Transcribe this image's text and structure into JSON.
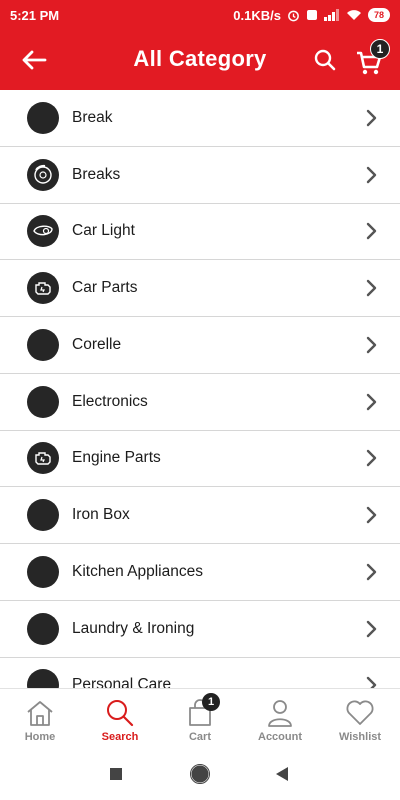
{
  "status_bar": {
    "time": "5:21 PM",
    "network_speed": "0.1KB/s",
    "battery": "78"
  },
  "app_bar": {
    "title": "All Category",
    "cart_badge": "1",
    "back_icon": "arrow-left-icon",
    "search_icon": "search-icon",
    "cart_icon": "cart-icon"
  },
  "categories": [
    {
      "label": "Break",
      "icon": "blank"
    },
    {
      "label": "Breaks",
      "icon": "brake-disc-icon"
    },
    {
      "label": "Car Light",
      "icon": "headlight-icon"
    },
    {
      "label": "Car Parts",
      "icon": "engine-icon"
    },
    {
      "label": "Corelle",
      "icon": "blank"
    },
    {
      "label": "Electronics",
      "icon": "blank"
    },
    {
      "label": "Engine Parts",
      "icon": "engine-icon"
    },
    {
      "label": "Iron Box",
      "icon": "blank"
    },
    {
      "label": "Kitchen Appliances",
      "icon": "blank"
    },
    {
      "label": "Laundry & Ironing",
      "icon": "blank"
    },
    {
      "label": "Personal Care",
      "icon": "blank"
    }
  ],
  "bottom_nav": [
    {
      "label": "Home",
      "icon": "home-icon",
      "active": false
    },
    {
      "label": "Search",
      "icon": "search-icon",
      "active": true
    },
    {
      "label": "Cart",
      "icon": "shopping-bag-icon",
      "active": false,
      "badge": "1"
    },
    {
      "label": "Account",
      "icon": "user-icon",
      "active": false
    },
    {
      "label": "Wishlist",
      "icon": "heart-icon",
      "active": false
    }
  ],
  "colors": {
    "brand": "#e21b23",
    "active_nav": "#d91c1c",
    "avatar": "#262626"
  }
}
